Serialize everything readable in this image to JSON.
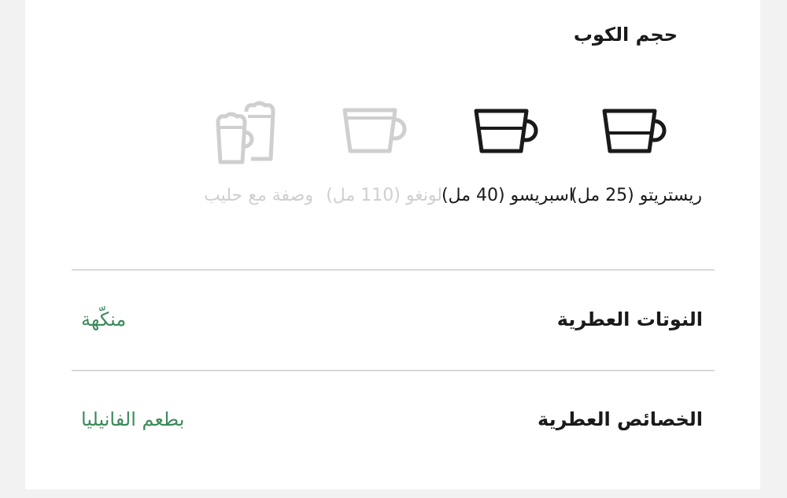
{
  "cup_size": {
    "title": "حجم الكوب",
    "options": [
      {
        "label": "ريستريتو (25 مل)",
        "icon": "ristretto-cup-icon",
        "active": true
      },
      {
        "label": "اسبريسو (40 مل)",
        "icon": "espresso-cup-icon",
        "active": true
      },
      {
        "label": "لونغو (110 مل)",
        "icon": "lungo-cup-icon",
        "active": false
      },
      {
        "label": "وصفة مع حليب",
        "icon": "milk-recipe-glasses-icon",
        "active": false
      }
    ]
  },
  "aromatic_notes": {
    "label": "النوتات العطرية",
    "value": "منكّهة"
  },
  "aromatic_profile": {
    "label": "الخصائص العطرية",
    "value": "بطعم الفانيليا"
  },
  "colors": {
    "accent_green": "#3b8a5a",
    "active_icon": "#1a1a1a",
    "inactive_icon": "#cfcfcf"
  }
}
